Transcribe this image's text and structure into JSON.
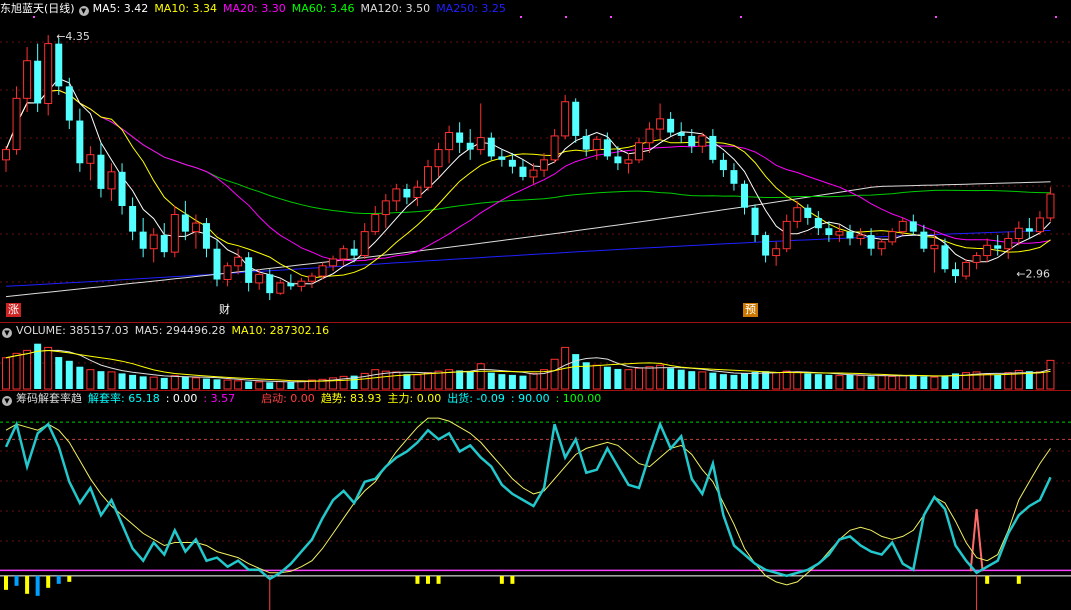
{
  "main_header": {
    "title": "东旭蓝天(日线)",
    "items": [
      {
        "label": "MA5: 3.42",
        "color": "#ffffff"
      },
      {
        "label": "MA10: 3.34",
        "color": "#ffff00"
      },
      {
        "label": "MA20: 3.30",
        "color": "#ff00ff"
      },
      {
        "label": "MA60: 3.46",
        "color": "#00ff00"
      },
      {
        "label": "MA120: 3.50",
        "color": "#dddddd"
      },
      {
        "label": "MA250: 3.25",
        "color": "#2020ff"
      }
    ]
  },
  "volume_header": {
    "items": [
      {
        "label": "VOLUME: 385157.03",
        "color": "#dddddd"
      },
      {
        "label": "MA5: 294496.28",
        "color": "#dddddd"
      },
      {
        "label": "MA10: 287302.16",
        "color": "#ffff00"
      }
    ]
  },
  "indicator_header": {
    "items": [
      {
        "label": "筹码解套率趋",
        "color": "#dddddd"
      },
      {
        "label": "解套率: 65.18",
        "color": "#00ffff"
      },
      {
        "label": ": 0.00",
        "color": "#ffffff"
      },
      {
        "label": ": 3.57",
        "color": "#ff00ff"
      },
      {
        "label": "启动: 0.00",
        "color": "#ff4040"
      },
      {
        "label": "趋势: 83.93",
        "color": "#ffff00"
      },
      {
        "label": "主力: 0.00",
        "color": "#ffff00"
      },
      {
        "label": "出货: -0.09",
        "color": "#00ffff"
      },
      {
        "label": ": 90.00",
        "color": "#00ffff"
      },
      {
        "label": ": 100.00",
        "color": "#00ff00"
      }
    ]
  },
  "tags": [
    {
      "text": "涨",
      "bg": "#cc2222",
      "color": "#ffffff",
      "x": 6
    },
    {
      "text": "财",
      "bg": "#000000",
      "color": "#ffffff",
      "x": 217
    },
    {
      "text": "预",
      "bg": "#cc7700",
      "color": "#ffffff",
      "x": 743
    }
  ],
  "chart_data": [
    {
      "type": "candlestick",
      "name_ref": "main_header.title",
      "n": 100,
      "ylim": [
        2.8,
        4.45
      ],
      "annotations": [
        {
          "text": "4.35",
          "index": 4,
          "value": 4.35
        },
        {
          "text": "2.96",
          "index": 95,
          "value": 2.96
        }
      ],
      "candles": [
        [
          3.62,
          3.7,
          3.55,
          3.68
        ],
        [
          3.68,
          4.05,
          3.65,
          3.98
        ],
        [
          3.98,
          4.28,
          3.9,
          4.2
        ],
        [
          4.2,
          4.3,
          3.9,
          3.95
        ],
        [
          3.95,
          4.35,
          3.88,
          4.3
        ],
        [
          4.3,
          4.33,
          4.0,
          4.05
        ],
        [
          4.05,
          4.1,
          3.8,
          3.85
        ],
        [
          3.85,
          3.92,
          3.55,
          3.6
        ],
        [
          3.6,
          3.7,
          3.5,
          3.65
        ],
        [
          3.65,
          3.72,
          3.4,
          3.45
        ],
        [
          3.45,
          3.6,
          3.38,
          3.55
        ],
        [
          3.55,
          3.6,
          3.3,
          3.35
        ],
        [
          3.35,
          3.4,
          3.15,
          3.2
        ],
        [
          3.2,
          3.28,
          3.05,
          3.1
        ],
        [
          3.1,
          3.22,
          3.02,
          3.18
        ],
        [
          3.18,
          3.25,
          3.05,
          3.08
        ],
        [
          3.08,
          3.35,
          3.05,
          3.3
        ],
        [
          3.3,
          3.38,
          3.15,
          3.2
        ],
        [
          3.2,
          3.3,
          3.1,
          3.25
        ],
        [
          3.25,
          3.28,
          3.05,
          3.1
        ],
        [
          3.1,
          3.15,
          2.88,
          2.92
        ],
        [
          2.92,
          3.02,
          2.88,
          3.0
        ],
        [
          3.0,
          3.1,
          2.95,
          3.05
        ],
        [
          3.05,
          3.08,
          2.85,
          2.9
        ],
        [
          2.9,
          2.98,
          2.86,
          2.95
        ],
        [
          2.95,
          2.98,
          2.8,
          2.84
        ],
        [
          2.84,
          2.92,
          2.83,
          2.9
        ],
        [
          2.9,
          2.95,
          2.86,
          2.88
        ],
        [
          2.88,
          2.93,
          2.85,
          2.91
        ],
        [
          2.91,
          2.96,
          2.87,
          2.94
        ],
        [
          2.94,
          3.02,
          2.92,
          3.0
        ],
        [
          3.0,
          3.06,
          2.97,
          3.04
        ],
        [
          3.04,
          3.12,
          3.0,
          3.1
        ],
        [
          3.1,
          3.15,
          3.02,
          3.06
        ],
        [
          3.06,
          3.25,
          3.04,
          3.2
        ],
        [
          3.2,
          3.35,
          3.18,
          3.3
        ],
        [
          3.3,
          3.42,
          3.22,
          3.38
        ],
        [
          3.38,
          3.48,
          3.32,
          3.45
        ],
        [
          3.45,
          3.48,
          3.36,
          3.4
        ],
        [
          3.4,
          3.5,
          3.35,
          3.46
        ],
        [
          3.46,
          3.62,
          3.44,
          3.58
        ],
        [
          3.58,
          3.72,
          3.52,
          3.68
        ],
        [
          3.68,
          3.82,
          3.6,
          3.78
        ],
        [
          3.78,
          3.84,
          3.66,
          3.72
        ],
        [
          3.72,
          3.8,
          3.62,
          3.68
        ],
        [
          3.68,
          3.95,
          3.65,
          3.75
        ],
        [
          3.75,
          3.78,
          3.62,
          3.64
        ],
        [
          3.64,
          3.68,
          3.58,
          3.62
        ],
        [
          3.62,
          3.66,
          3.54,
          3.58
        ],
        [
          3.58,
          3.62,
          3.5,
          3.52
        ],
        [
          3.52,
          3.6,
          3.48,
          3.56
        ],
        [
          3.56,
          3.66,
          3.52,
          3.62
        ],
        [
          3.62,
          3.8,
          3.6,
          3.76
        ],
        [
          3.76,
          4.0,
          3.74,
          3.96
        ],
        [
          3.96,
          3.98,
          3.72,
          3.76
        ],
        [
          3.76,
          3.8,
          3.64,
          3.68
        ],
        [
          3.68,
          3.76,
          3.62,
          3.74
        ],
        [
          3.74,
          3.78,
          3.62,
          3.64
        ],
        [
          3.64,
          3.7,
          3.56,
          3.6
        ],
        [
          3.6,
          3.66,
          3.54,
          3.62
        ],
        [
          3.62,
          3.75,
          3.6,
          3.72
        ],
        [
          3.72,
          3.84,
          3.66,
          3.8
        ],
        [
          3.8,
          3.95,
          3.74,
          3.86
        ],
        [
          3.86,
          3.9,
          3.76,
          3.78
        ],
        [
          3.78,
          3.84,
          3.72,
          3.76
        ],
        [
          3.76,
          3.8,
          3.66,
          3.7
        ],
        [
          3.7,
          3.78,
          3.66,
          3.76
        ],
        [
          3.76,
          3.8,
          3.6,
          3.62
        ],
        [
          3.62,
          3.66,
          3.52,
          3.56
        ],
        [
          3.56,
          3.6,
          3.44,
          3.48
        ],
        [
          3.48,
          3.5,
          3.3,
          3.34
        ],
        [
          3.34,
          3.36,
          3.14,
          3.18
        ],
        [
          3.18,
          3.2,
          3.02,
          3.06
        ],
        [
          3.06,
          3.14,
          3.0,
          3.1
        ],
        [
          3.1,
          3.3,
          3.08,
          3.26
        ],
        [
          3.26,
          3.38,
          3.22,
          3.34
        ],
        [
          3.34,
          3.36,
          3.24,
          3.28
        ],
        [
          3.28,
          3.32,
          3.18,
          3.22
        ],
        [
          3.22,
          3.26,
          3.14,
          3.18
        ],
        [
          3.18,
          3.24,
          3.14,
          3.2
        ],
        [
          3.2,
          3.24,
          3.12,
          3.16
        ],
        [
          3.16,
          3.22,
          3.12,
          3.18
        ],
        [
          3.18,
          3.22,
          3.06,
          3.1
        ],
        [
          3.1,
          3.16,
          3.06,
          3.14
        ],
        [
          3.14,
          3.22,
          3.12,
          3.2
        ],
        [
          3.2,
          3.28,
          3.18,
          3.26
        ],
        [
          3.26,
          3.3,
          3.18,
          3.2
        ],
        [
          3.2,
          3.24,
          3.08,
          3.1
        ],
        [
          3.1,
          3.2,
          2.96,
          3.12
        ],
        [
          3.12,
          3.16,
          2.96,
          2.98
        ],
        [
          2.98,
          3.02,
          2.9,
          2.94
        ],
        [
          2.94,
          3.04,
          2.92,
          3.02
        ],
        [
          3.02,
          3.08,
          2.98,
          3.06
        ],
        [
          3.06,
          3.16,
          3.02,
          3.12
        ],
        [
          3.12,
          3.18,
          3.06,
          3.1
        ],
        [
          3.1,
          3.2,
          3.04,
          3.16
        ],
        [
          3.16,
          3.26,
          3.12,
          3.22
        ],
        [
          3.22,
          3.28,
          3.16,
          3.2
        ],
        [
          3.2,
          3.32,
          3.18,
          3.28
        ],
        [
          3.28,
          3.46,
          3.26,
          3.42
        ]
      ],
      "ma250_range": [
        2.88,
        3.25
      ],
      "ma120_range": [
        2.82,
        3.5
      ]
    },
    {
      "type": "bar",
      "name_ref": "volume_header",
      "ylim": [
        0,
        700000
      ],
      "values": [
        420000,
        480000,
        520000,
        610000,
        560000,
        430000,
        380000,
        300000,
        260000,
        240000,
        230000,
        210000,
        190000,
        170000,
        160000,
        150000,
        180000,
        170000,
        150000,
        140000,
        130000,
        120000,
        110000,
        100000,
        95000,
        90000,
        100000,
        95000,
        110000,
        120000,
        130000,
        150000,
        170000,
        180000,
        210000,
        260000,
        240000,
        230000,
        200000,
        190000,
        220000,
        240000,
        260000,
        250000,
        230000,
        340000,
        220000,
        200000,
        190000,
        180000,
        210000,
        260000,
        400000,
        560000,
        470000,
        360000,
        320000,
        300000,
        270000,
        260000,
        280000,
        300000,
        320000,
        280000,
        260000,
        240000,
        230000,
        220000,
        200000,
        190000,
        210000,
        230000,
        240000,
        220000,
        240000,
        230000,
        210000,
        200000,
        190000,
        180000,
        190000,
        180000,
        170000,
        180000,
        170000,
        180000,
        190000,
        170000,
        160000,
        180000,
        210000,
        220000,
        230000,
        200000,
        190000,
        220000,
        250000,
        240000,
        230000,
        385157
      ]
    },
    {
      "type": "line",
      "name_ref": "indicator_header",
      "ylim": [
        -10,
        110
      ],
      "reference_lines": [
        100,
        90,
        0,
        3.57
      ],
      "series": [
        {
          "ref": "解套率",
          "color": "#22c8cc",
          "values": [
            85,
            100,
            72,
            94,
            100,
            85,
            62,
            48,
            58,
            40,
            50,
            34,
            18,
            10,
            22,
            14,
            30,
            16,
            24,
            10,
            12,
            6,
            10,
            4,
            4,
            -2,
            2,
            8,
            16,
            24,
            38,
            50,
            56,
            48,
            62,
            64,
            72,
            78,
            82,
            88,
            96,
            90,
            94,
            82,
            86,
            78,
            72,
            60,
            54,
            50,
            46,
            58,
            100,
            78,
            90,
            68,
            70,
            84,
            72,
            60,
            58,
            80,
            100,
            84,
            92,
            64,
            54,
            74,
            40,
            20,
            14,
            8,
            4,
            2,
            0,
            2,
            4,
            8,
            14,
            24,
            26,
            20,
            16,
            14,
            22,
            8,
            4,
            40,
            52,
            44,
            20,
            10,
            2,
            6,
            10,
            28,
            40,
            46,
            50,
            65
          ]
        },
        {
          "ref": "趋势",
          "color": "#f0f060",
          "values": [
            96,
            100,
            98,
            96,
            100,
            96,
            88,
            76,
            64,
            54,
            46,
            40,
            34,
            28,
            24,
            20,
            22,
            22,
            22,
            20,
            16,
            14,
            12,
            8,
            5,
            2,
            2,
            3,
            6,
            10,
            18,
            28,
            38,
            48,
            56,
            62,
            72,
            82,
            90,
            98,
            104,
            104,
            102,
            98,
            94,
            88,
            80,
            72,
            64,
            58,
            54,
            56,
            64,
            72,
            80,
            84,
            86,
            88,
            86,
            80,
            74,
            72,
            78,
            84,
            86,
            80,
            70,
            62,
            48,
            34,
            18,
            8,
            0,
            -4,
            -6,
            -4,
            2,
            8,
            16,
            24,
            30,
            32,
            30,
            26,
            24,
            26,
            30,
            40,
            52,
            48,
            36,
            22,
            12,
            10,
            14,
            30,
            50,
            62,
            74,
            84
          ]
        },
        {
          "ref": "启动",
          "color": "#ff6b6b",
          "spike": {
            "index": 92,
            "value": 44
          }
        }
      ]
    }
  ]
}
